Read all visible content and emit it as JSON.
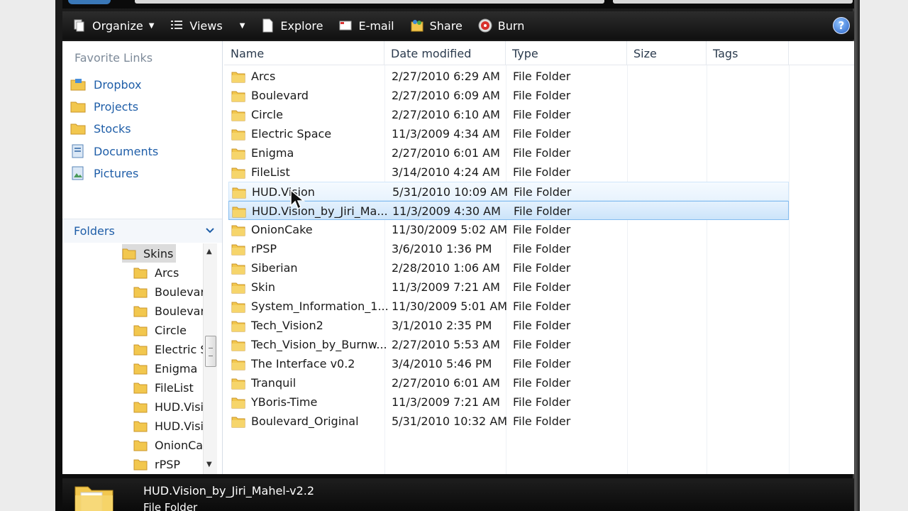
{
  "toolbar": {
    "organize": "Organize",
    "views": "Views",
    "explore": "Explore",
    "email": "E-mail",
    "share": "Share",
    "burn": "Burn",
    "help": "?"
  },
  "nav": {
    "favorites_title": "Favorite Links",
    "favorites": [
      "Dropbox",
      "Projects",
      "Stocks",
      "Documents",
      "Pictures"
    ],
    "folders_title": "Folders",
    "tree_root": "Skins",
    "tree_items": [
      "Arcs",
      "Boulevar",
      "Boulevar",
      "Circle",
      "Electric S",
      "Enigma",
      "FileList",
      "HUD.Visi",
      "HUD.Visi",
      "OnionCa",
      "rPSP"
    ]
  },
  "columns": {
    "name": "Name",
    "date": "Date modified",
    "type": "Type",
    "size": "Size",
    "tags": "Tags"
  },
  "files": [
    {
      "name": "Arcs",
      "date": "2/27/2010 6:29 AM",
      "type": "File Folder"
    },
    {
      "name": "Boulevard",
      "date": "2/27/2010 6:09 AM",
      "type": "File Folder"
    },
    {
      "name": "Circle",
      "date": "2/27/2010 6:10 AM",
      "type": "File Folder"
    },
    {
      "name": "Electric Space",
      "date": "11/3/2009 4:34 AM",
      "type": "File Folder"
    },
    {
      "name": "Enigma",
      "date": "2/27/2010 6:01 AM",
      "type": "File Folder"
    },
    {
      "name": "FileList",
      "date": "3/14/2010 4:24 AM",
      "type": "File Folder"
    },
    {
      "name": "HUD.Vision",
      "date": "5/31/2010 10:09 AM",
      "type": "File Folder"
    },
    {
      "name": "HUD.Vision_by_Jiri_Ma...",
      "date": "11/3/2009 4:30 AM",
      "type": "File Folder"
    },
    {
      "name": "OnionCake",
      "date": "11/30/2009 5:02 AM",
      "type": "File Folder"
    },
    {
      "name": "rPSP",
      "date": "3/6/2010 1:36 PM",
      "type": "File Folder"
    },
    {
      "name": "Siberian",
      "date": "2/28/2010 1:06 AM",
      "type": "File Folder"
    },
    {
      "name": "Skin",
      "date": "11/3/2009 7:21 AM",
      "type": "File Folder"
    },
    {
      "name": "System_Information_1...",
      "date": "11/30/2009 5:01 AM",
      "type": "File Folder"
    },
    {
      "name": "Tech_Vision2",
      "date": "3/1/2010 2:35 PM",
      "type": "File Folder"
    },
    {
      "name": "Tech_Vision_by_Burnw...",
      "date": "2/27/2010 5:53 AM",
      "type": "File Folder"
    },
    {
      "name": "The Interface v0.2",
      "date": "3/4/2010 5:46 PM",
      "type": "File Folder"
    },
    {
      "name": "Tranquil",
      "date": "2/27/2010 6:01 AM",
      "type": "File Folder"
    },
    {
      "name": "YBoris-Time",
      "date": "11/3/2009 7:21 AM",
      "type": "File Folder"
    },
    {
      "name": "Boulevard_Original",
      "date": "5/31/2010 10:32 AM",
      "type": "File Folder"
    }
  ],
  "hovered_index": 6,
  "selected_index": 7,
  "details": {
    "name": "HUD.Vision_by_Jiri_Mahel-v2.2",
    "type": "File Folder"
  },
  "colors": {
    "link": "#1f5ea8",
    "folder": "#f2c74e",
    "selection": "#cce4fa"
  }
}
